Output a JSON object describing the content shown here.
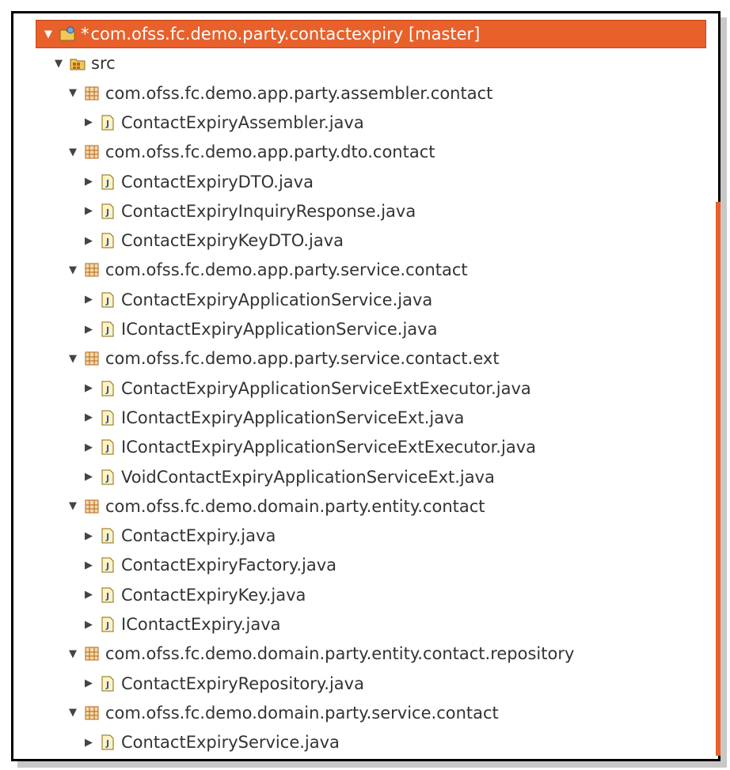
{
  "project": {
    "dirty_marker": "*",
    "label": "com.ofss.fc.demo.party.contactexpiry [master]",
    "icon": "project-icon"
  },
  "source_folder": {
    "label": "src",
    "icon": "source-folder-icon"
  },
  "packages": [
    {
      "label": "com.ofss.fc.demo.app.party.assembler.contact",
      "files": [
        {
          "label": "ContactExpiryAssembler.java"
        }
      ]
    },
    {
      "label": "com.ofss.fc.demo.app.party.dto.contact",
      "files": [
        {
          "label": "ContactExpiryDTO.java"
        },
        {
          "label": "ContactExpiryInquiryResponse.java"
        },
        {
          "label": "ContactExpiryKeyDTO.java"
        }
      ]
    },
    {
      "label": "com.ofss.fc.demo.app.party.service.contact",
      "files": [
        {
          "label": "ContactExpiryApplicationService.java"
        },
        {
          "label": "IContactExpiryApplicationService.java"
        }
      ]
    },
    {
      "label": "com.ofss.fc.demo.app.party.service.contact.ext",
      "files": [
        {
          "label": "ContactExpiryApplicationServiceExtExecutor.java"
        },
        {
          "label": "IContactExpiryApplicationServiceExt.java"
        },
        {
          "label": "IContactExpiryApplicationServiceExtExecutor.java"
        },
        {
          "label": "VoidContactExpiryApplicationServiceExt.java"
        }
      ]
    },
    {
      "label": "com.ofss.fc.demo.domain.party.entity.contact",
      "files": [
        {
          "label": "ContactExpiry.java"
        },
        {
          "label": "ContactExpiryFactory.java"
        },
        {
          "label": "ContactExpiryKey.java"
        },
        {
          "label": "IContactExpiry.java"
        }
      ]
    },
    {
      "label": "com.ofss.fc.demo.domain.party.entity.contact.repository",
      "files": [
        {
          "label": "ContactExpiryRepository.java"
        }
      ]
    },
    {
      "label": "com.ofss.fc.demo.domain.party.service.contact",
      "files": [
        {
          "label": "ContactExpiryService.java"
        }
      ]
    }
  ],
  "colors": {
    "selection": "#e8602a",
    "package_icon": "#b5651d",
    "java_icon": "#2b5fa8"
  }
}
